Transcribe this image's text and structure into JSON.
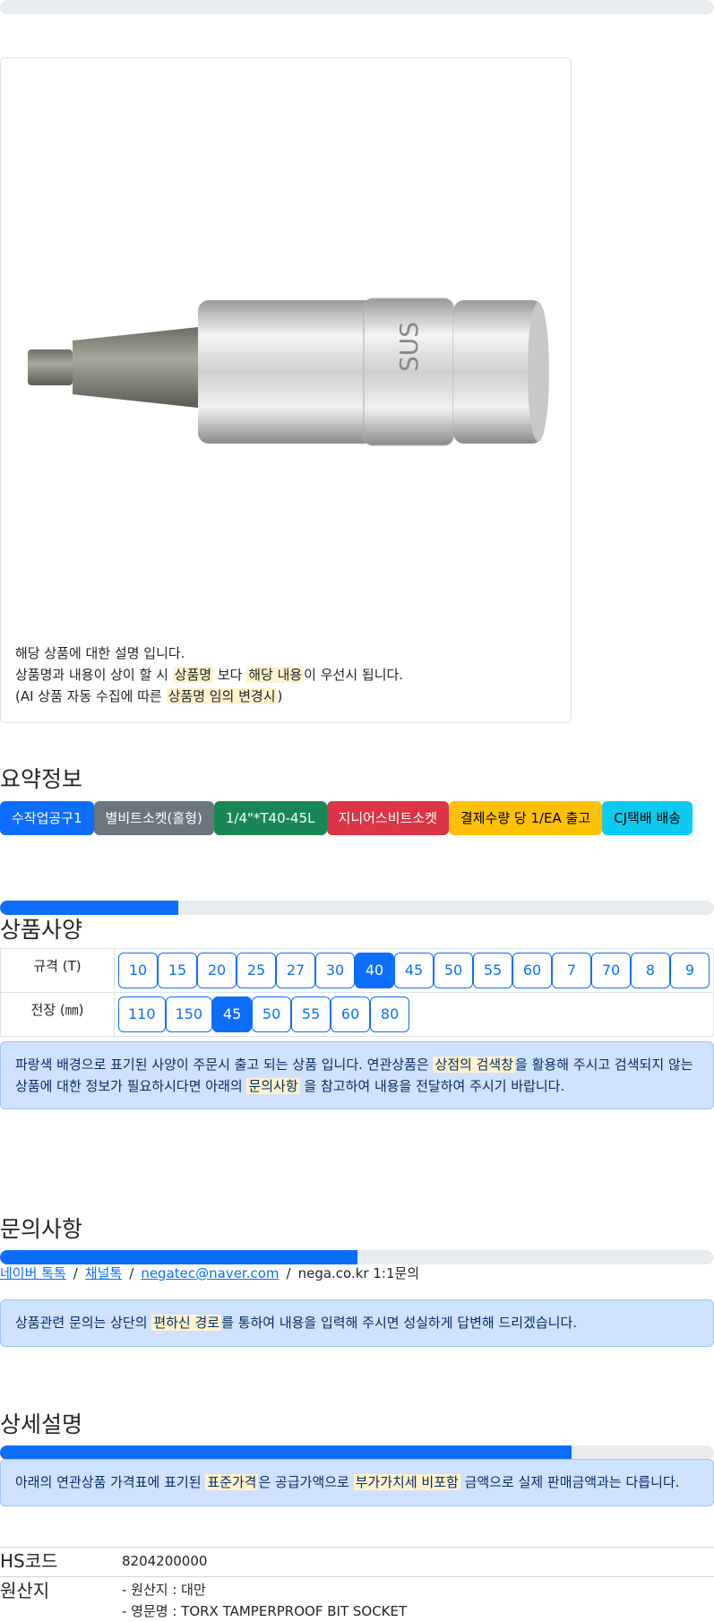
{
  "product": {
    "image_alt": "TORX TAMPERPROOF BIT SOCKET",
    "note_line1": "해당 상품에 대한 설명 입니다.",
    "note_line2_a": "상품명과 내용이 상이 할 시 ",
    "note_line2_hl1": "상품명",
    "note_line2_b": " 보다 ",
    "note_line2_hl2": "해당 내용",
    "note_line2_c": "이 우선시 됩니다.",
    "note_line3_a": "(AI 상품 자동 수집에 따른 ",
    "note_line3_hl": "상품명 임의 변경시",
    "note_line3_b": ")"
  },
  "summary": {
    "title": "요약정보",
    "badges": [
      {
        "label": "수작업공구1",
        "color": "#0d6efd"
      },
      {
        "label": "별비트소켓(홀형)",
        "color": "#6c757d"
      },
      {
        "label": "1/4\"*T40-45L",
        "color": "#198754"
      },
      {
        "label": "지니어스비트소켓",
        "color": "#dc3545"
      },
      {
        "label": "결제수량 당 1/EA 출고",
        "color": "#ffc107",
        "text_color": "#000000"
      },
      {
        "label": "CJ택배 배송",
        "color": "#0dcaf0",
        "text_color": "#000000"
      }
    ]
  },
  "spec": {
    "title": "상품사양",
    "progress": 0.25,
    "rows": [
      {
        "label": "규격 (T)",
        "options": [
          "10",
          "15",
          "20",
          "25",
          "27",
          "30",
          "40",
          "45",
          "50",
          "55",
          "60",
          "7",
          "70",
          "8",
          "9"
        ],
        "selected": "40"
      },
      {
        "label": "전장 (㎜)",
        "options": [
          "110",
          "150",
          "45",
          "50",
          "55",
          "60",
          "80"
        ],
        "selected": "45"
      }
    ],
    "notice_a": "파랑색 배경으로 표기된 사양이 주문시 출고 되는 상품 입니다. 연관상품은 ",
    "notice_hl1": "상점의 검색창",
    "notice_b": "을 활용해 주시고 검색되지 않는 상품에 대한 정보가 필요하시다면 아래의 ",
    "notice_hl2": "문의사항",
    "notice_c": " 을 참고하여 내용을 전달하여 주시기 바랍니다."
  },
  "inquiry": {
    "title": "문의사항",
    "progress": 0.5,
    "links": [
      "네이버 톡톡",
      "채널톡",
      "negatec@naver.com"
    ],
    "plain_link": "nega.co.kr 1:1문의",
    "notice_a": "상품관련 문의는 상단의 ",
    "notice_hl": "편하신 경로",
    "notice_b": "를 통하여 내용을 입력해 주시면 성실하게 답변해 드리겠습니다."
  },
  "detail": {
    "title": "상세설명",
    "progress": 0.8,
    "notice_a": "아래의 연관상품 가격표에 표기된 ",
    "notice_hl1": "표준가격",
    "notice_b": "은 공급가액으로 ",
    "notice_hl2": "부가가치세 비포함",
    "notice_c": " 금액으로 실제 판매금액과는 다릅니다.",
    "hs_label": "HS코드",
    "hs_value": "8204200000",
    "origin_label": "원산지",
    "origin_line1": "- 원산지 : 대만",
    "origin_line2": "- 영문명 : TORX TAMPERPROOF BIT SOCKET"
  }
}
